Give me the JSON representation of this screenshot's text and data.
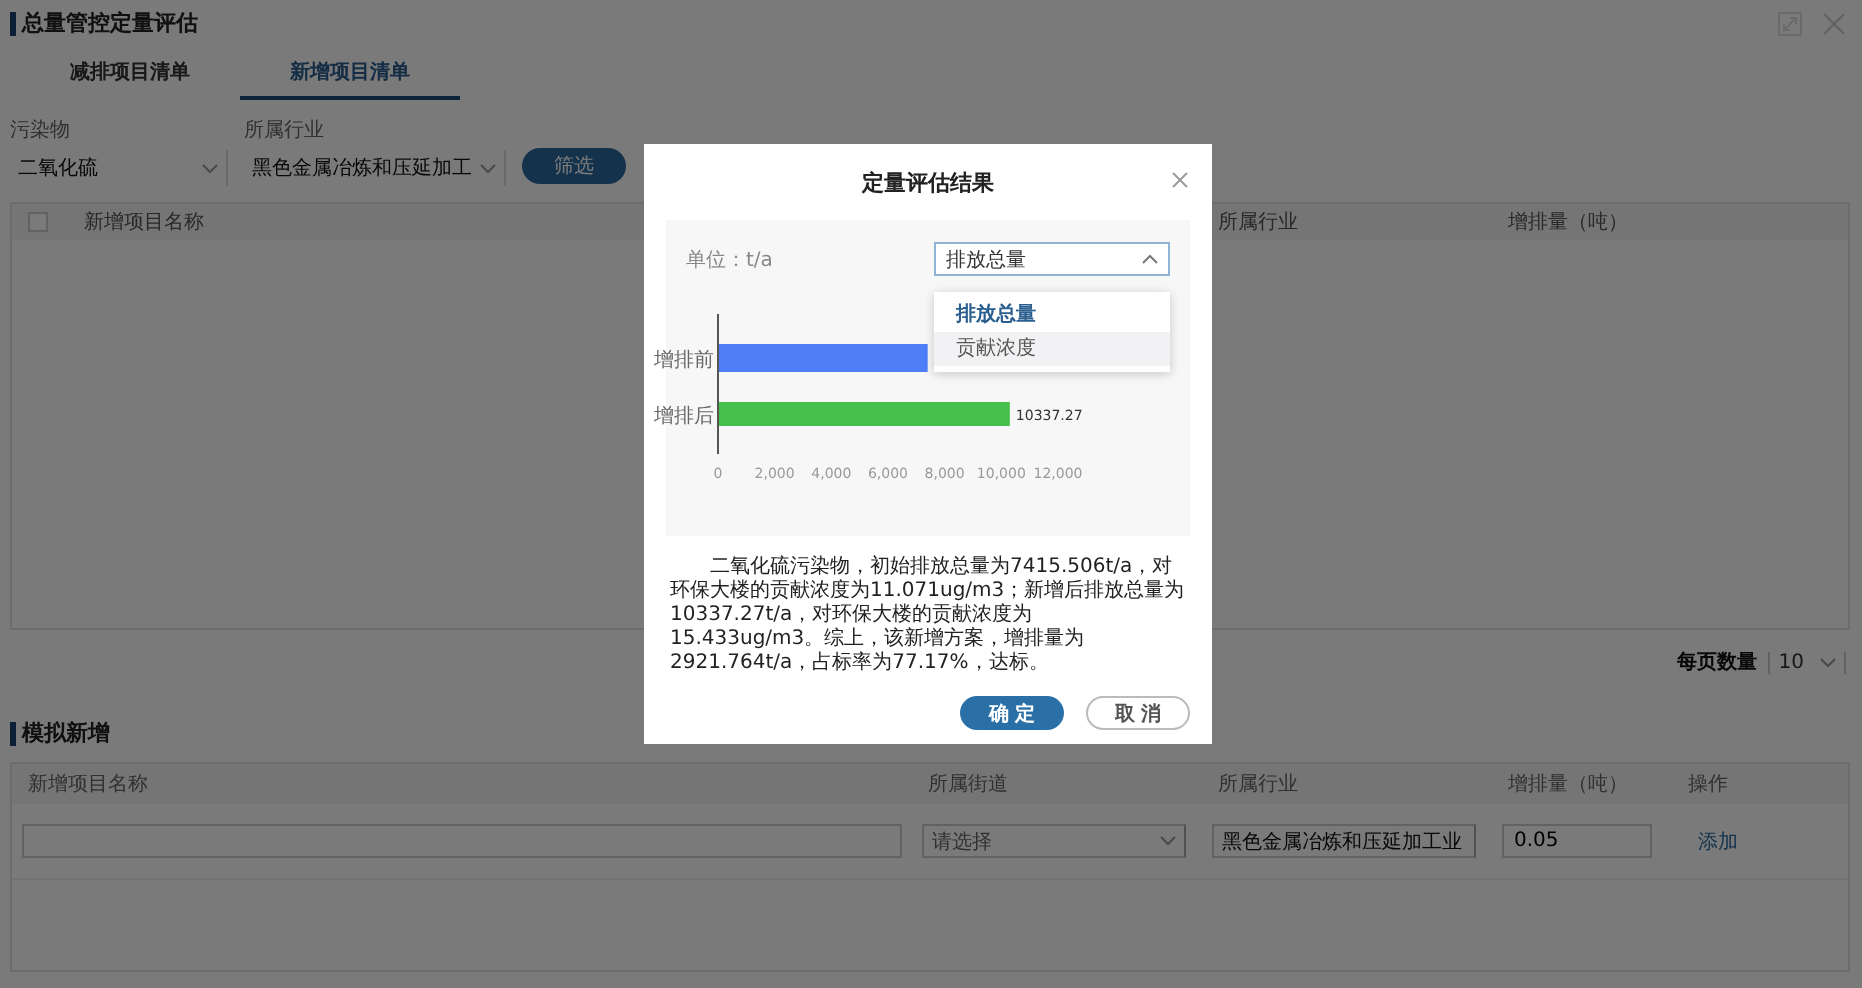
{
  "window": {
    "title": "总量管控定量评估"
  },
  "tabs": [
    {
      "label": "减排项目清单",
      "selected": false
    },
    {
      "label": "新增项目清单",
      "selected": true
    }
  ],
  "filters": [
    {
      "label": "污染物",
      "value": "二氧化硫"
    },
    {
      "label": "所属行业",
      "value": "黑色金属冶炼和压延加工"
    }
  ],
  "filter_button": "筛选",
  "project_table": {
    "select_all_checked": false,
    "columns": [
      "新增项目名称",
      "所属行业",
      "增排量（吨）"
    ]
  },
  "pagination": {
    "label": "每页数量",
    "page_size": "10"
  },
  "simulate": {
    "title": "模拟新增",
    "columns": [
      "新增项目名称",
      "所属街道",
      "所属行业",
      "增排量（吨）",
      "操作"
    ],
    "row": {
      "street": {
        "placeholder": "请选择"
      },
      "industry": "黑色金属冶炼和压延加工业",
      "amount": "0.05",
      "action": "添加"
    }
  },
  "dialog": {
    "title": "定量评估结果",
    "unit": "单位：t/a",
    "metric_select": {
      "value": "排放总量",
      "expanded": true,
      "options": [
        {
          "label": "排放总量",
          "selected": true
        },
        {
          "label": "贡献浓度",
          "selected": false
        }
      ]
    },
    "chart_data": {
      "type": "bar",
      "orientation": "horizontal",
      "categories": [
        "增排前",
        "增排后"
      ],
      "series": [
        {
          "color": "#4f7ff8",
          "values": [
            7400,
            null
          ]
        },
        {
          "color": "#46c04a",
          "values": [
            null,
            10300
          ]
        }
      ],
      "stacked": true,
      "xlim": [
        0,
        12000
      ],
      "xticks": [
        {
          "value": 0,
          "label": "0"
        },
        {
          "value": 2000,
          "label": "2,000"
        },
        {
          "value": 4000,
          "label": "4,000"
        },
        {
          "value": 6000,
          "label": "6,000"
        },
        {
          "value": 8000,
          "label": "8,000"
        },
        {
          "value": 10000,
          "label": "10,000"
        },
        {
          "value": 12000,
          "label": "12,000"
        }
      ],
      "value_labels": [
        null,
        "10337.27"
      ]
    },
    "summary": "二氧化硫污染物，初始排放总量为7415.506t/a，对环保大楼的贡献浓度为11.071ug/m3；新增后排放总量为10337.27t/a，对环保大楼的贡献浓度为15.433ug/m3。综上，该新增方案，增排量为2921.764t/a，占标率为77.17%，达标。",
    "buttons": [
      {
        "label": "确 定",
        "kind": "primary"
      },
      {
        "label": "取 消",
        "kind": "secondary"
      }
    ]
  }
}
